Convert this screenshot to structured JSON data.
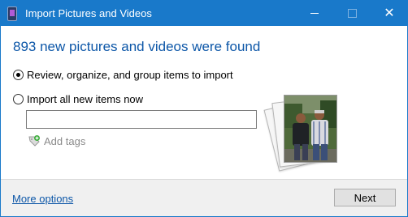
{
  "window": {
    "title": "Import Pictures and Videos",
    "title_color": "#1979ca",
    "app_icon": "phone-icon",
    "controls": {
      "minimize_icon": "minimize-icon",
      "maximize_icon": "maximize-icon",
      "close_icon": "close-icon",
      "close_glyph": "✕"
    }
  },
  "content": {
    "headline": "893 new pictures and videos were found",
    "headline_color": "#0d57a8",
    "options": [
      {
        "label": "Review, organize, and group items to import",
        "selected": true
      },
      {
        "label": "Import all new items now",
        "selected": false
      }
    ],
    "tags_input": {
      "value": "",
      "placeholder": ""
    },
    "add_tags": {
      "label": "Add tags",
      "icon": "tag-add-icon"
    },
    "preview": {
      "icon": "photo-stack-thumbnail"
    }
  },
  "footer": {
    "more_options_label": "More options",
    "next_label": "Next",
    "link_color": "#0d57a8"
  }
}
